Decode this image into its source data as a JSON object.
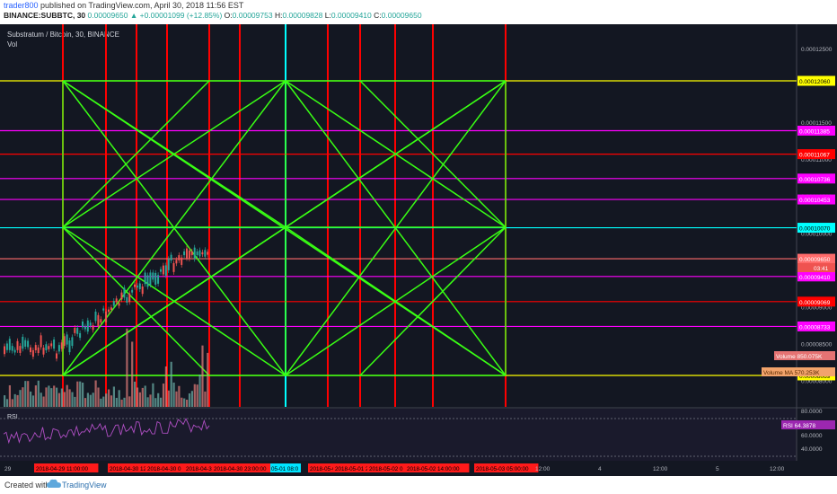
{
  "header": {
    "user": "trader800",
    "published": "published on TradingView.com, April 30, 2018 11:56 EST",
    "ticker_line": "BINANCE:SUBBTC, 30",
    "price_now": "0.00009650",
    "change": "▲ +0.00001099 (+12.85%)",
    "o_label": "O:",
    "o_value": "0.00009753",
    "h_label": "H:",
    "h_value": "0.00009828",
    "l_label": "L:",
    "l_value": "0.00009410",
    "c_label": "C:",
    "c_value": "0.00009650"
  },
  "chart_data": {
    "type": "candlestick",
    "title": "Substratum / Bitcoin, 30, BINANCE",
    "volume_label": "Vol",
    "price_axis_ticks": [
      "0.00012500",
      "0.00011500",
      "0.00011000",
      "0.00010500",
      "0.00010000",
      "0.00009500",
      "0.00009000",
      "0.00008500",
      "0.00008000"
    ],
    "horizontal_levels": [
      {
        "value": "0.00012060",
        "color": "#ffff00"
      },
      {
        "value": "0.00011385",
        "color": "#ff00ff"
      },
      {
        "value": "0.00011067",
        "color": "#ff0000"
      },
      {
        "value": "0.00010736",
        "color": "#ff00ff"
      },
      {
        "value": "0.00010453",
        "color": "#ff00ff"
      },
      {
        "value": "0.00010070",
        "color": "#00ffff"
      },
      {
        "value": "0.00009650",
        "color": "#ff6b6b"
      },
      {
        "value": "0.00009410",
        "color": "#ff00ff"
      },
      {
        "value": "0.00009069",
        "color": "#ff0000"
      },
      {
        "value": "0.00008733",
        "color": "#ff00ff"
      },
      {
        "value": "0.00008069",
        "color": "#ffff00"
      }
    ],
    "countdown": "03:41",
    "volume_badge": {
      "label": "Volume",
      "value": "850.075K"
    },
    "volume_ma_badge": {
      "label": "Volume MA",
      "value": "570.253K"
    },
    "rsi": {
      "label": "RSI",
      "value": "64.3878",
      "ticks": [
        "80.0000",
        "60.0000",
        "40.0000"
      ]
    },
    "time_axis": {
      "plain": [
        {
          "t": "29"
        },
        {
          "t": "12:00"
        },
        {
          "t": "4"
        },
        {
          "t": "12:00"
        },
        {
          "t": "5"
        },
        {
          "t": "12:00"
        }
      ],
      "red": [
        "2018-04-29 11:00:00",
        "2018-04-30 12:00:00",
        "2018-04-30 0",
        "2018-04-3",
        "2018-04-30 23:00:00",
        "2018-05-0",
        "2018-05-01 2",
        "2018-05-02 0",
        "2018-05-02 14:00:00",
        "2018-05-03 05:00:00"
      ],
      "cyan": "05-01 08:0"
    }
  },
  "footer": {
    "created_with": "Created with",
    "brand": "TradingView"
  },
  "colors": {
    "background": "#131722",
    "grid_red": "#ff0000",
    "grid_cyan": "#00ffff",
    "fan_green": "#39ff14",
    "fill": "#8b8b25",
    "up": "#26a69a",
    "down": "#ef5350"
  },
  "icons": {
    "logo": "tradingview-cloud-icon"
  }
}
